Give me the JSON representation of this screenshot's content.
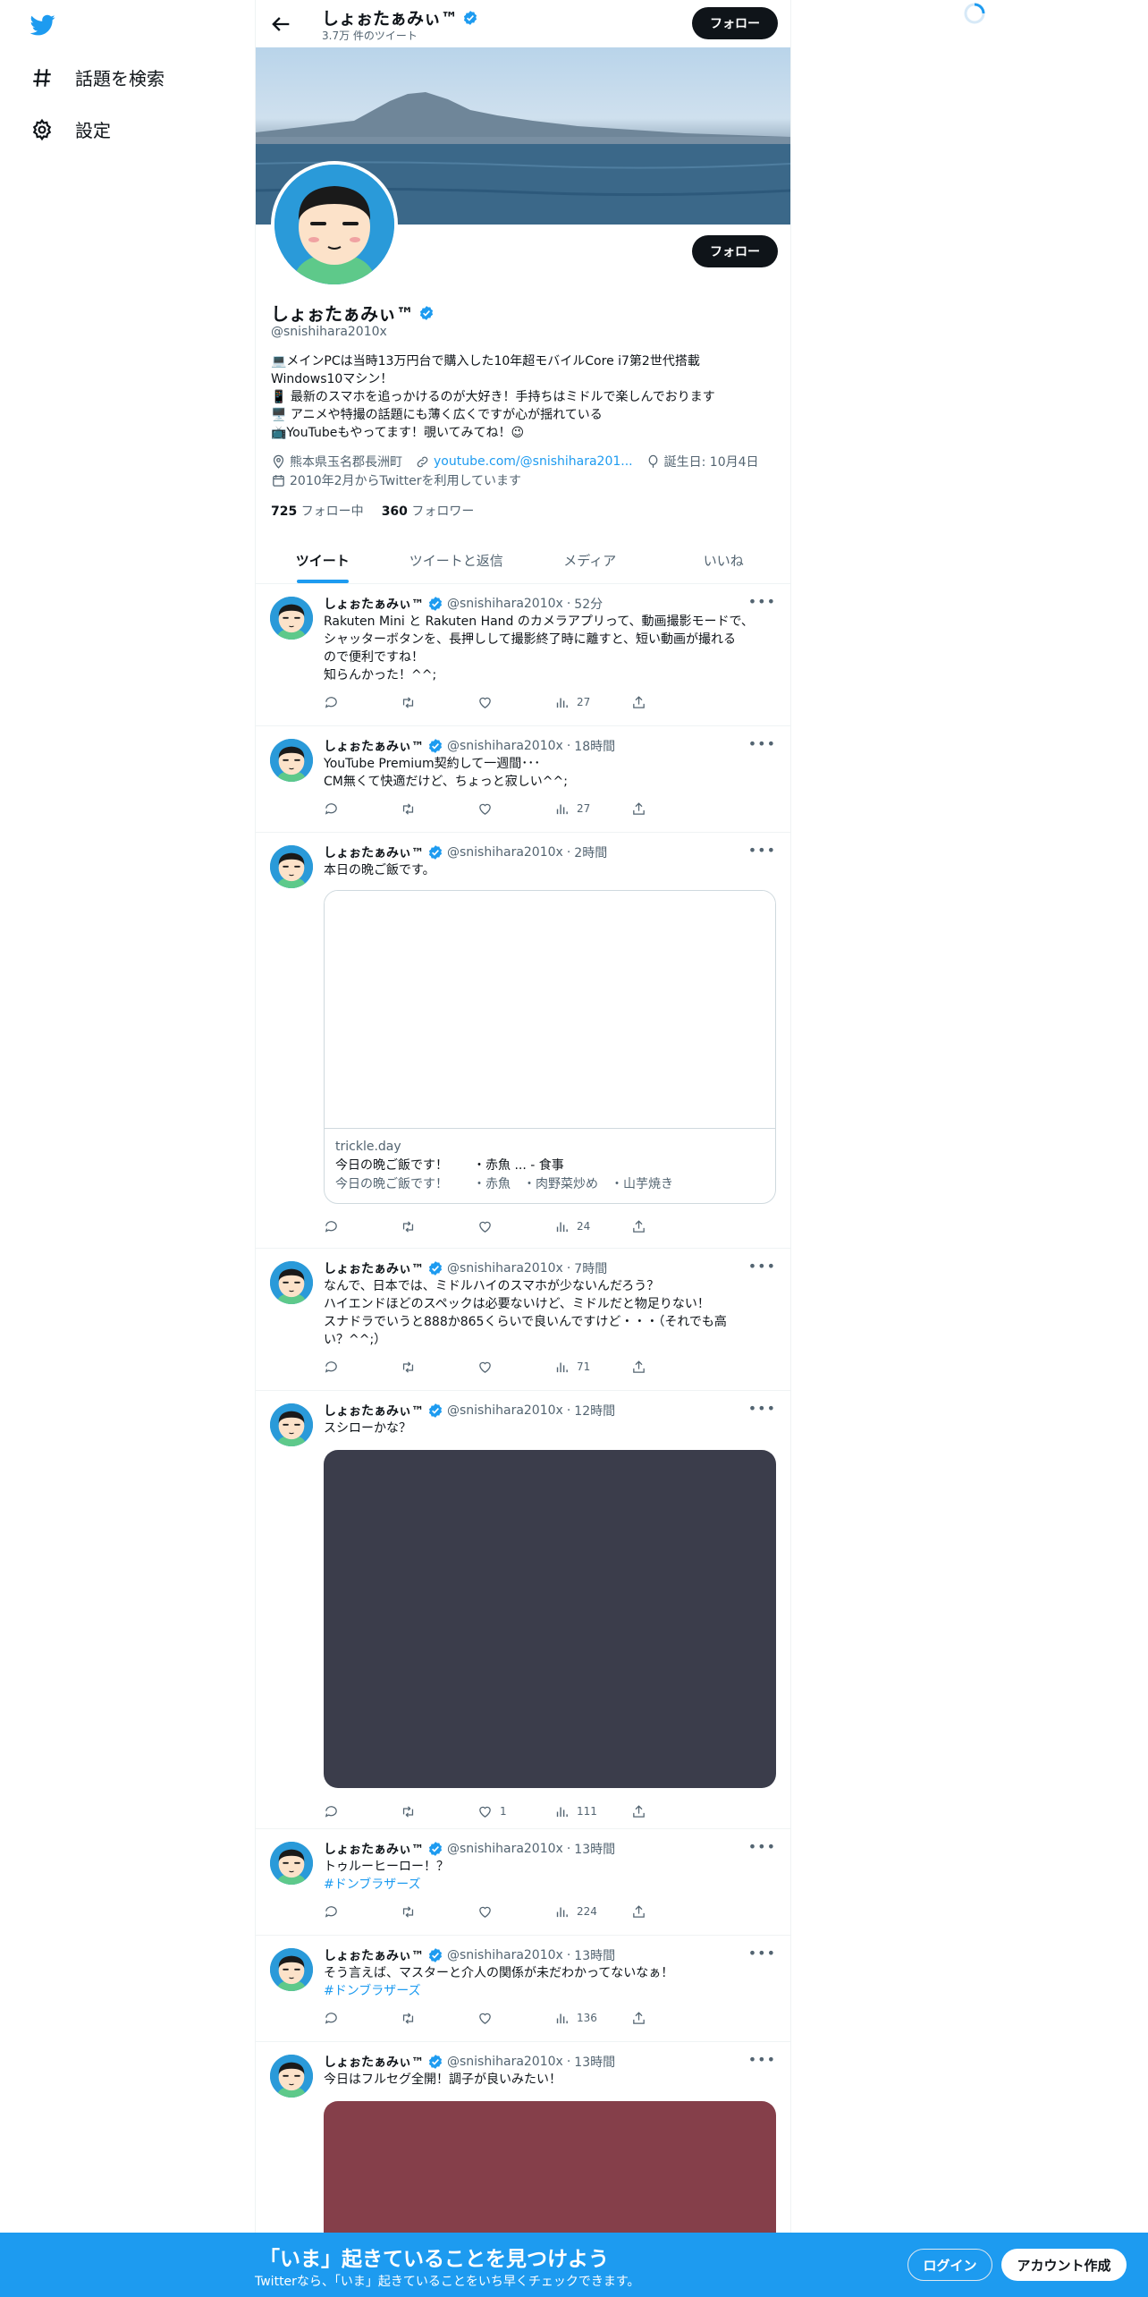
{
  "nav": {
    "logo": "twitter-bird-icon",
    "items": [
      {
        "label": "話題を検索",
        "icon": "hashtag-icon"
      },
      {
        "label": "設定",
        "icon": "gear-icon"
      }
    ]
  },
  "header": {
    "name": "しょぉたぁみぃ™",
    "tweet_count": "3.7万 件のツイート",
    "follow_label": "フォロー"
  },
  "profile": {
    "name": "しょぉたぁみぃ™",
    "handle": "@snishihara2010x",
    "follow_label": "フォロー",
    "bio": [
      "💻メインPCは当時13万円台で購入した10年超モバイルCore i7第2世代搭載",
      "Windows10マシン！",
      "📱 最新のスマホを追っかけるのが大好き！手持ちはミドルで楽しんでおります",
      "🖥️ アニメや特撮の話題にも薄く広くですが心が揺れている",
      "📺YouTubeもやってます！覗いてみてね！😉"
    ],
    "location": "熊本県玉名郡長洲町",
    "url": "youtube.com/@snishihara201...",
    "birthday": "誕生日: 10月4日",
    "joined": "2010年2月からTwitterを利用しています",
    "following_count": "725",
    "following_label": "フォロー中",
    "followers_count": "360",
    "followers_label": "フォロワー"
  },
  "tabs": [
    "ツイート",
    "ツイートと返信",
    "メディア",
    "いいね"
  ],
  "tweets": [
    {
      "name": "しょぉたぁみぃ™",
      "handle": "@snishihara2010x",
      "time": "52分",
      "lines": [
        "Rakuten Mini と Rakuten Hand のカメラアプリって、動画撮影モードで、",
        "シャッターボタンを、長押しして撮影終了時に離すと、短い動画が撮れる",
        "ので便利ですね！",
        "知らんかった！^^;"
      ],
      "replies": "",
      "retweets": "",
      "likes": "",
      "views": "27"
    },
    {
      "name": "しょぉたぁみぃ™",
      "handle": "@snishihara2010x",
      "time": "18時間",
      "lines": [
        "YouTube Premium契約して一週間･･･",
        "CM無くて快適だけど、ちょっと寂しい^^;"
      ],
      "replies": "",
      "retweets": "",
      "likes": "",
      "views": "27"
    },
    {
      "name": "しょぉたぁみぃ™",
      "handle": "@snishihara2010x",
      "time": "2時間",
      "lines": [
        "本日の晩ご飯です。"
      ],
      "card": {
        "domain": "trickle.day",
        "title": "今日の晩ご飯です！　　・赤魚 ... - 食事",
        "desc": "今日の晩ご飯です！　　・赤魚　・肉野菜炒め　・山芋焼き"
      },
      "replies": "",
      "retweets": "",
      "likes": "",
      "views": "24"
    },
    {
      "name": "しょぉたぁみぃ™",
      "handle": "@snishihara2010x",
      "time": "7時間",
      "lines": [
        "なんで、日本では、ミドルハイのスマホが少ないんだろう？",
        "ハイエンドほどのスペックは必要ないけど、ミドルだと物足りない！",
        "スナドラでいうと888か865くらいで良いんですけど・・・（それでも高",
        "い？^^;）"
      ],
      "replies": "",
      "retweets": "",
      "likes": "",
      "views": "71"
    },
    {
      "name": "しょぉたぁみぃ™",
      "handle": "@snishihara2010x",
      "time": "12時間",
      "lines": [
        "スシローかな？"
      ],
      "media_color": "#3b3d4b",
      "replies": "",
      "retweets": "",
      "likes": "1",
      "views": "111"
    },
    {
      "name": "しょぉたぁみぃ™",
      "handle": "@snishihara2010x",
      "time": "13時間",
      "lines": [
        "トゥルーヒーロー！？"
      ],
      "hashtag": "#ドンブラザーズ",
      "replies": "",
      "retweets": "",
      "likes": "",
      "views": "224"
    },
    {
      "name": "しょぉたぁみぃ™",
      "handle": "@snishihara2010x",
      "time": "13時間",
      "lines": [
        "そう言えば、マスターと介人の関係が未だわかってないなぁ！"
      ],
      "hashtag": "#ドンブラザーズ",
      "replies": "",
      "retweets": "",
      "likes": "",
      "views": "136"
    },
    {
      "name": "しょぉたぁみぃ™",
      "handle": "@snishihara2010x",
      "time": "13時間",
      "lines": [
        "今日はフルセグ全開！調子が良いみたい！"
      ],
      "media_color": "#853f4a",
      "replies": "",
      "retweets": "",
      "likes": "",
      "views": ""
    }
  ],
  "bottom": {
    "title": "「いま」起きていることを見つけよう",
    "subtitle": "Twitterなら、「いま」起きていることをいち早くチェックできます。",
    "login": "ログイン",
    "signup": "アカウント作成"
  },
  "colors": {
    "accent": "#1d9bf0",
    "dark": "#0f1419",
    "muted": "#536471"
  }
}
